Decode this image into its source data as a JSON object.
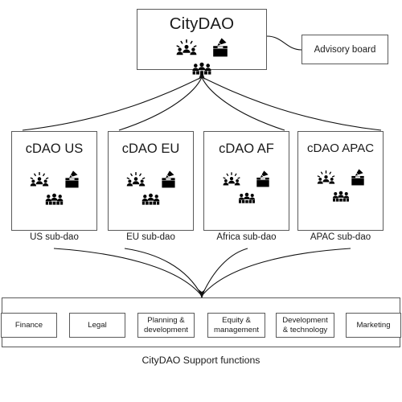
{
  "diagram": {
    "title_text": "CityDAO",
    "root": {
      "label": "CityDAO",
      "icons": [
        "community-meeting-icon",
        "ballot-box-icon",
        "people-group-icon"
      ]
    },
    "advisory": {
      "label": "Advisory board"
    },
    "subdaos": [
      {
        "label": "cDAO US",
        "caption": "US sub-dao",
        "icons": [
          "community-meeting-icon",
          "ballot-box-icon",
          "people-group-icon"
        ]
      },
      {
        "label": "cDAO EU",
        "caption": "EU sub-dao",
        "icons": [
          "community-meeting-icon",
          "ballot-box-icon",
          "people-group-icon"
        ]
      },
      {
        "label": "cDAO AF",
        "caption": "Africa sub-dao",
        "icons": [
          "community-meeting-icon",
          "ballot-box-icon",
          "people-group-icon"
        ]
      },
      {
        "label": "cDAO APAC",
        "caption": "APAC sub-dao",
        "icons": [
          "community-meeting-icon",
          "ballot-box-icon",
          "people-group-icon"
        ]
      }
    ],
    "support": {
      "caption": "CityDAO Support functions",
      "items": [
        {
          "label": "Finance"
        },
        {
          "label": "Legal"
        },
        {
          "label": "Planning &\ndevelopment"
        },
        {
          "label": "Equity &\nmanagement"
        },
        {
          "label": "Development\n& technology"
        },
        {
          "label": "Marketing"
        }
      ]
    },
    "colors": {
      "stroke": "#5a5a5a",
      "edge": "#111111",
      "text": "#1a1a1a",
      "background": "#ffffff"
    }
  }
}
